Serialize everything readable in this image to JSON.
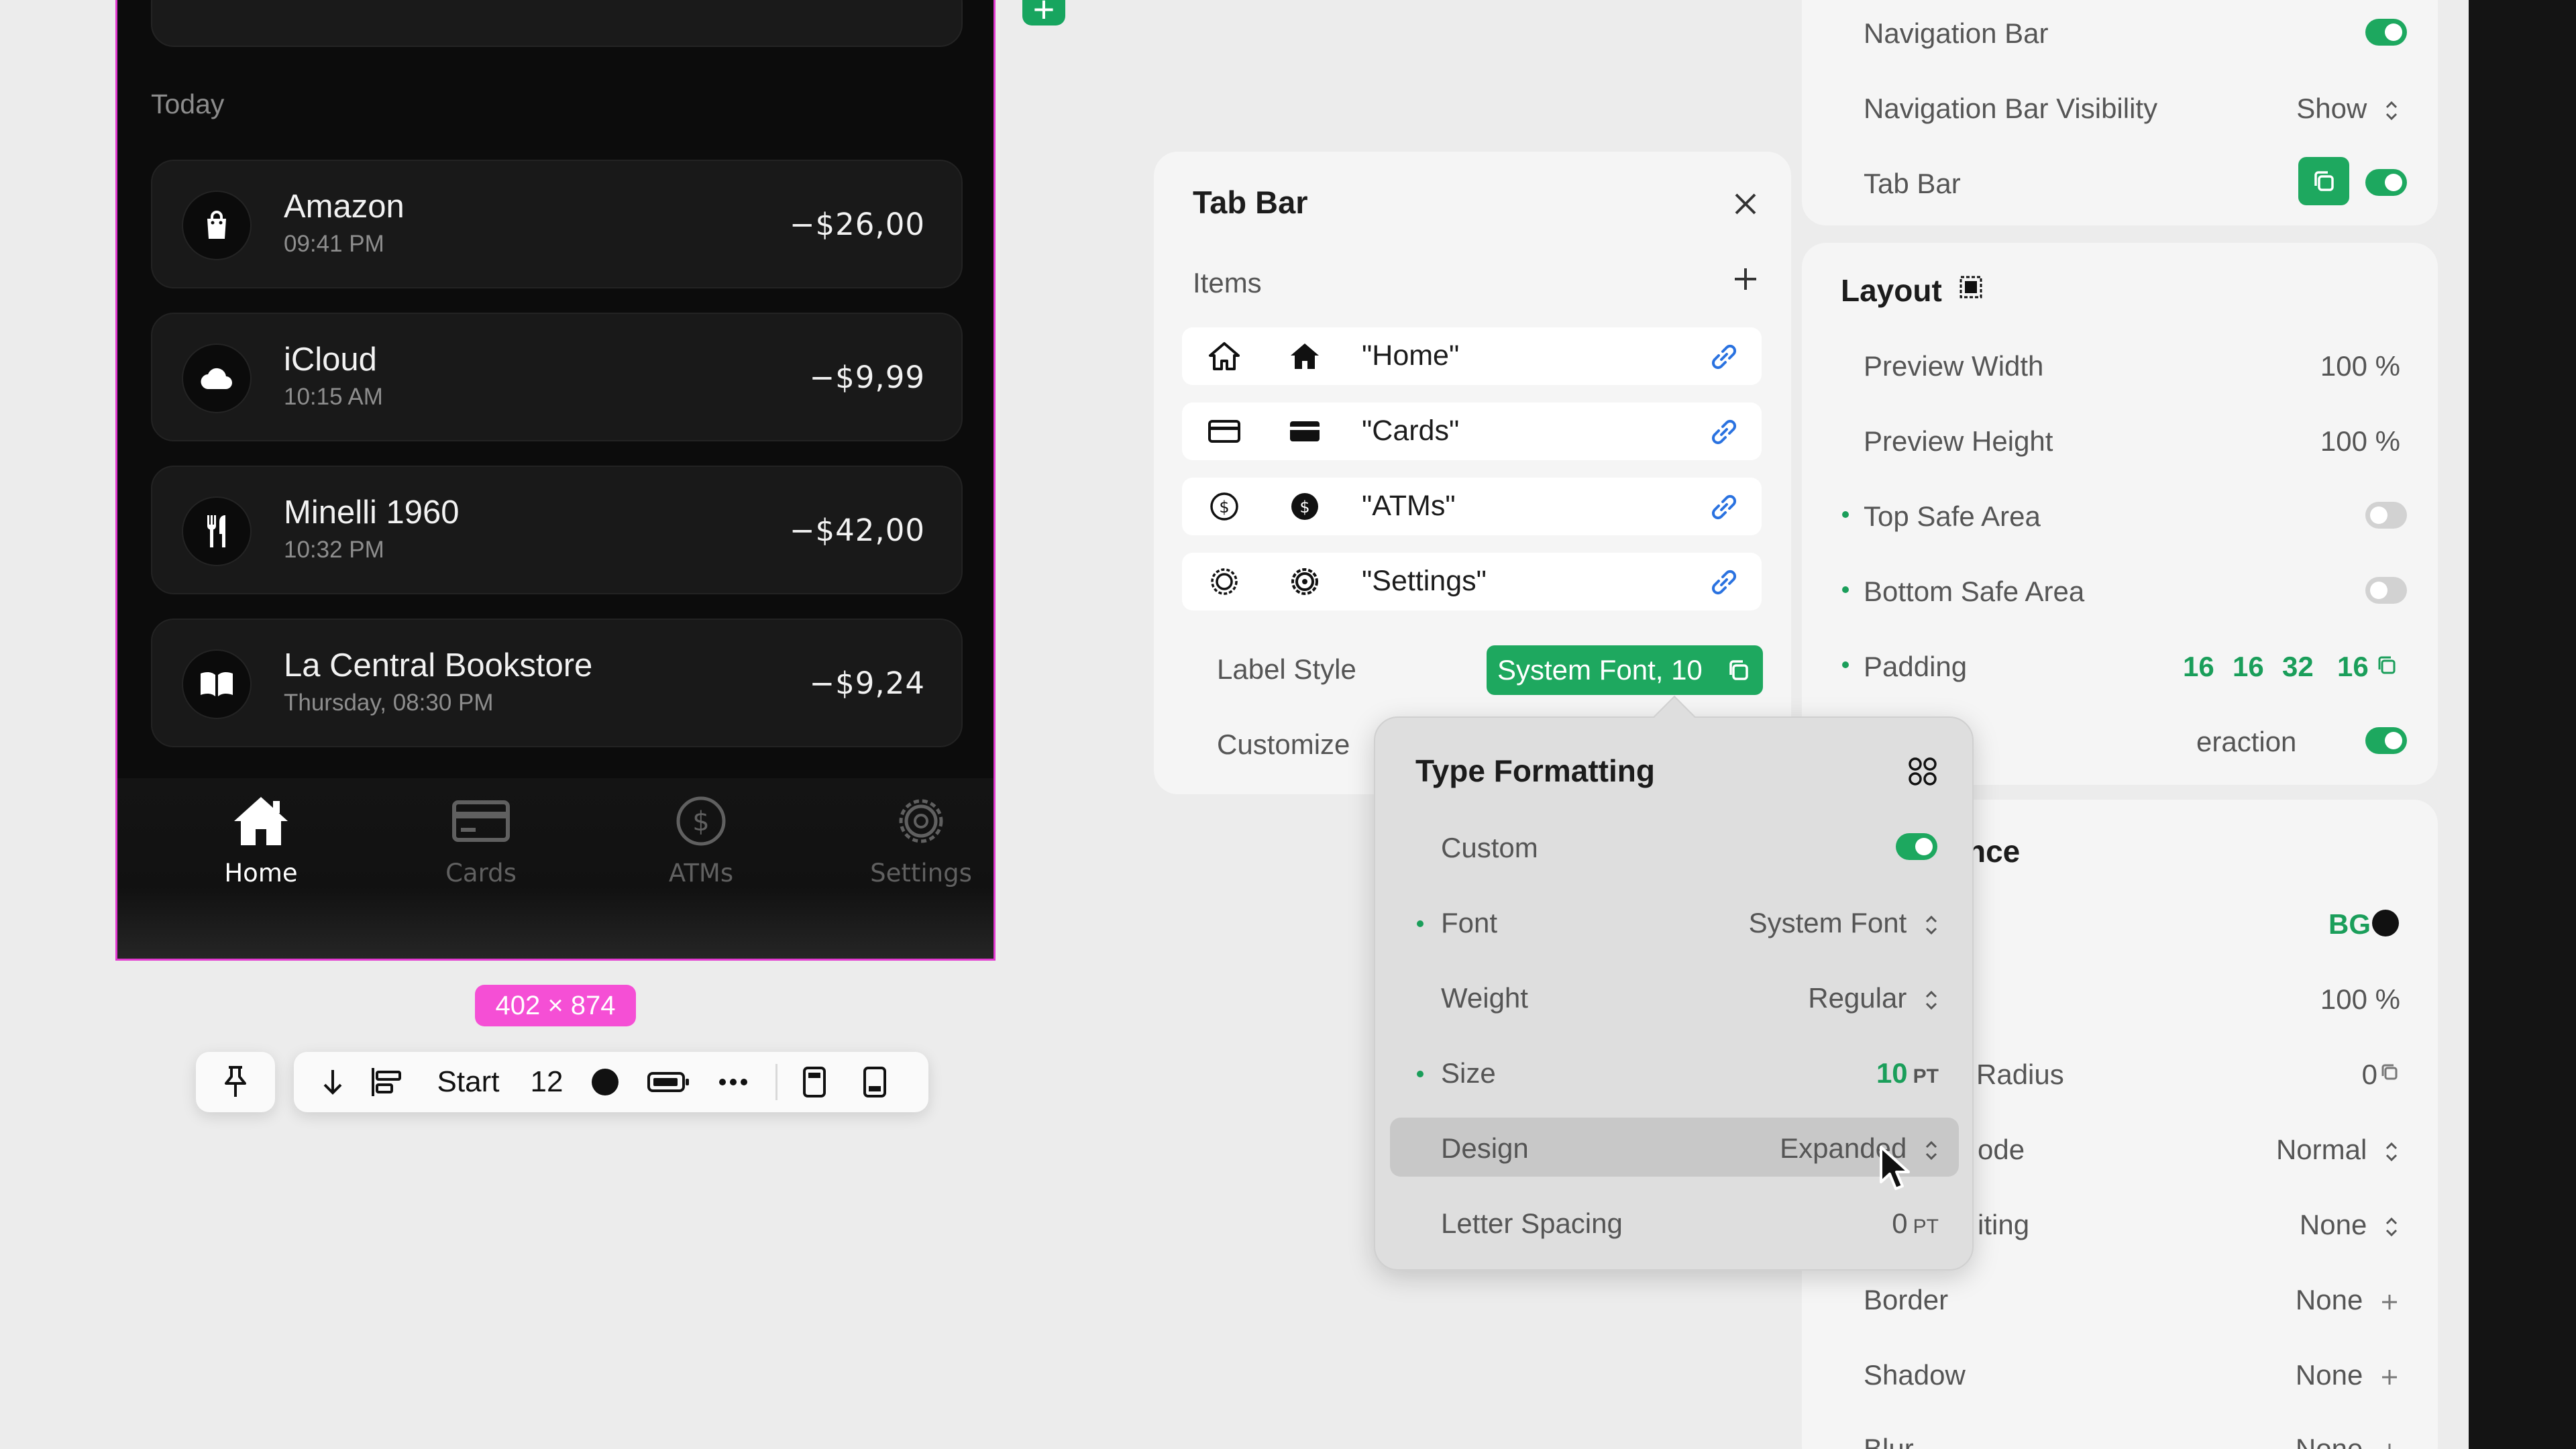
{
  "phone": {
    "section_label": "Today",
    "transactions": [
      {
        "name": "Amazon",
        "time": "09:41 PM",
        "amount": "−$26,00",
        "icon": "shopping-bag-icon"
      },
      {
        "name": "iCloud",
        "time": "10:15 AM",
        "amount": "−$9,99",
        "icon": "cloud-icon"
      },
      {
        "name": "Minelli 1960",
        "time": "10:32 PM",
        "amount": "−$42,00",
        "icon": "fork-knife-icon"
      },
      {
        "name": "La Central Bookstore",
        "time": "Thursday, 08:30 PM",
        "amount": "−$9,24",
        "icon": "book-icon"
      }
    ],
    "tabs": [
      {
        "label": "Home",
        "icon": "house-icon",
        "active": true
      },
      {
        "label": "Cards",
        "icon": "credit-card-icon",
        "active": false
      },
      {
        "label": "ATMs",
        "icon": "dollar-circle-icon",
        "active": false
      },
      {
        "label": "Settings",
        "icon": "gear-icon",
        "active": false
      }
    ]
  },
  "canvas": {
    "dimension_badge": "402 × 874",
    "toolbar": {
      "alignment_label": "Start",
      "spacing_value": "12"
    }
  },
  "tab_bar_panel": {
    "title": "Tab Bar",
    "items_label": "Items",
    "items": [
      {
        "label": "\"Home\"",
        "icon_outline": "house-outline-icon",
        "icon_filled": "house-filled-icon"
      },
      {
        "label": "\"Cards\"",
        "icon_outline": "credit-card-outline-icon",
        "icon_filled": "credit-card-filled-icon"
      },
      {
        "label": "\"ATMs\"",
        "icon_outline": "dollar-circle-outline-icon",
        "icon_filled": "dollar-circle-filled-icon"
      },
      {
        "label": "\"Settings\"",
        "icon_outline": "gear-outline-icon",
        "icon_filled": "gear-filled-icon"
      }
    ],
    "label_style_label": "Label Style",
    "label_style_value": "System Font, 10",
    "customize_label": "Customize"
  },
  "inspector": {
    "nav_bar_label": "Navigation Bar",
    "nav_bar_visibility_label": "Navigation Bar Visibility",
    "nav_bar_visibility_value": "Show",
    "tab_bar_label": "Tab Bar",
    "layout_title": "Layout",
    "preview_width_label": "Preview Width",
    "preview_width_value": "100 %",
    "preview_height_label": "Preview Height",
    "preview_height_value": "100 %",
    "top_safe_label": "Top Safe Area",
    "bottom_safe_label": "Bottom Safe Area",
    "padding_label": "Padding",
    "padding_values": [
      "16",
      "16",
      "32",
      "16"
    ],
    "interaction_label_partial": "eraction",
    "appearance_title_partial": "nce",
    "bg_value": "BG",
    "opacity_value": "100 %",
    "radius_label_partial": "Radius",
    "radius_value": "0",
    "mode_label_partial": "ode",
    "mode_value": "Normal",
    "compositing_label_partial": "iting",
    "compositing_value": "None",
    "border_label": "Border",
    "border_value": "None",
    "shadow_label": "Shadow",
    "shadow_value": "None",
    "blur_label": "Blur",
    "blur_value": "None"
  },
  "type_formatting": {
    "title": "Type Formatting",
    "custom_label": "Custom",
    "font_label": "Font",
    "font_value": "System Font",
    "weight_label": "Weight",
    "weight_value": "Regular",
    "size_label": "Size",
    "size_value": "10",
    "size_unit": "PT",
    "design_label": "Design",
    "design_value": "Expanded",
    "letter_spacing_label": "Letter Spacing",
    "letter_spacing_value": "0",
    "letter_spacing_unit": "PT"
  },
  "colors": {
    "accent_green": "#1a9e5a",
    "dimension_pink": "#f54fd5",
    "phone_bg": "#0c0c0c"
  }
}
